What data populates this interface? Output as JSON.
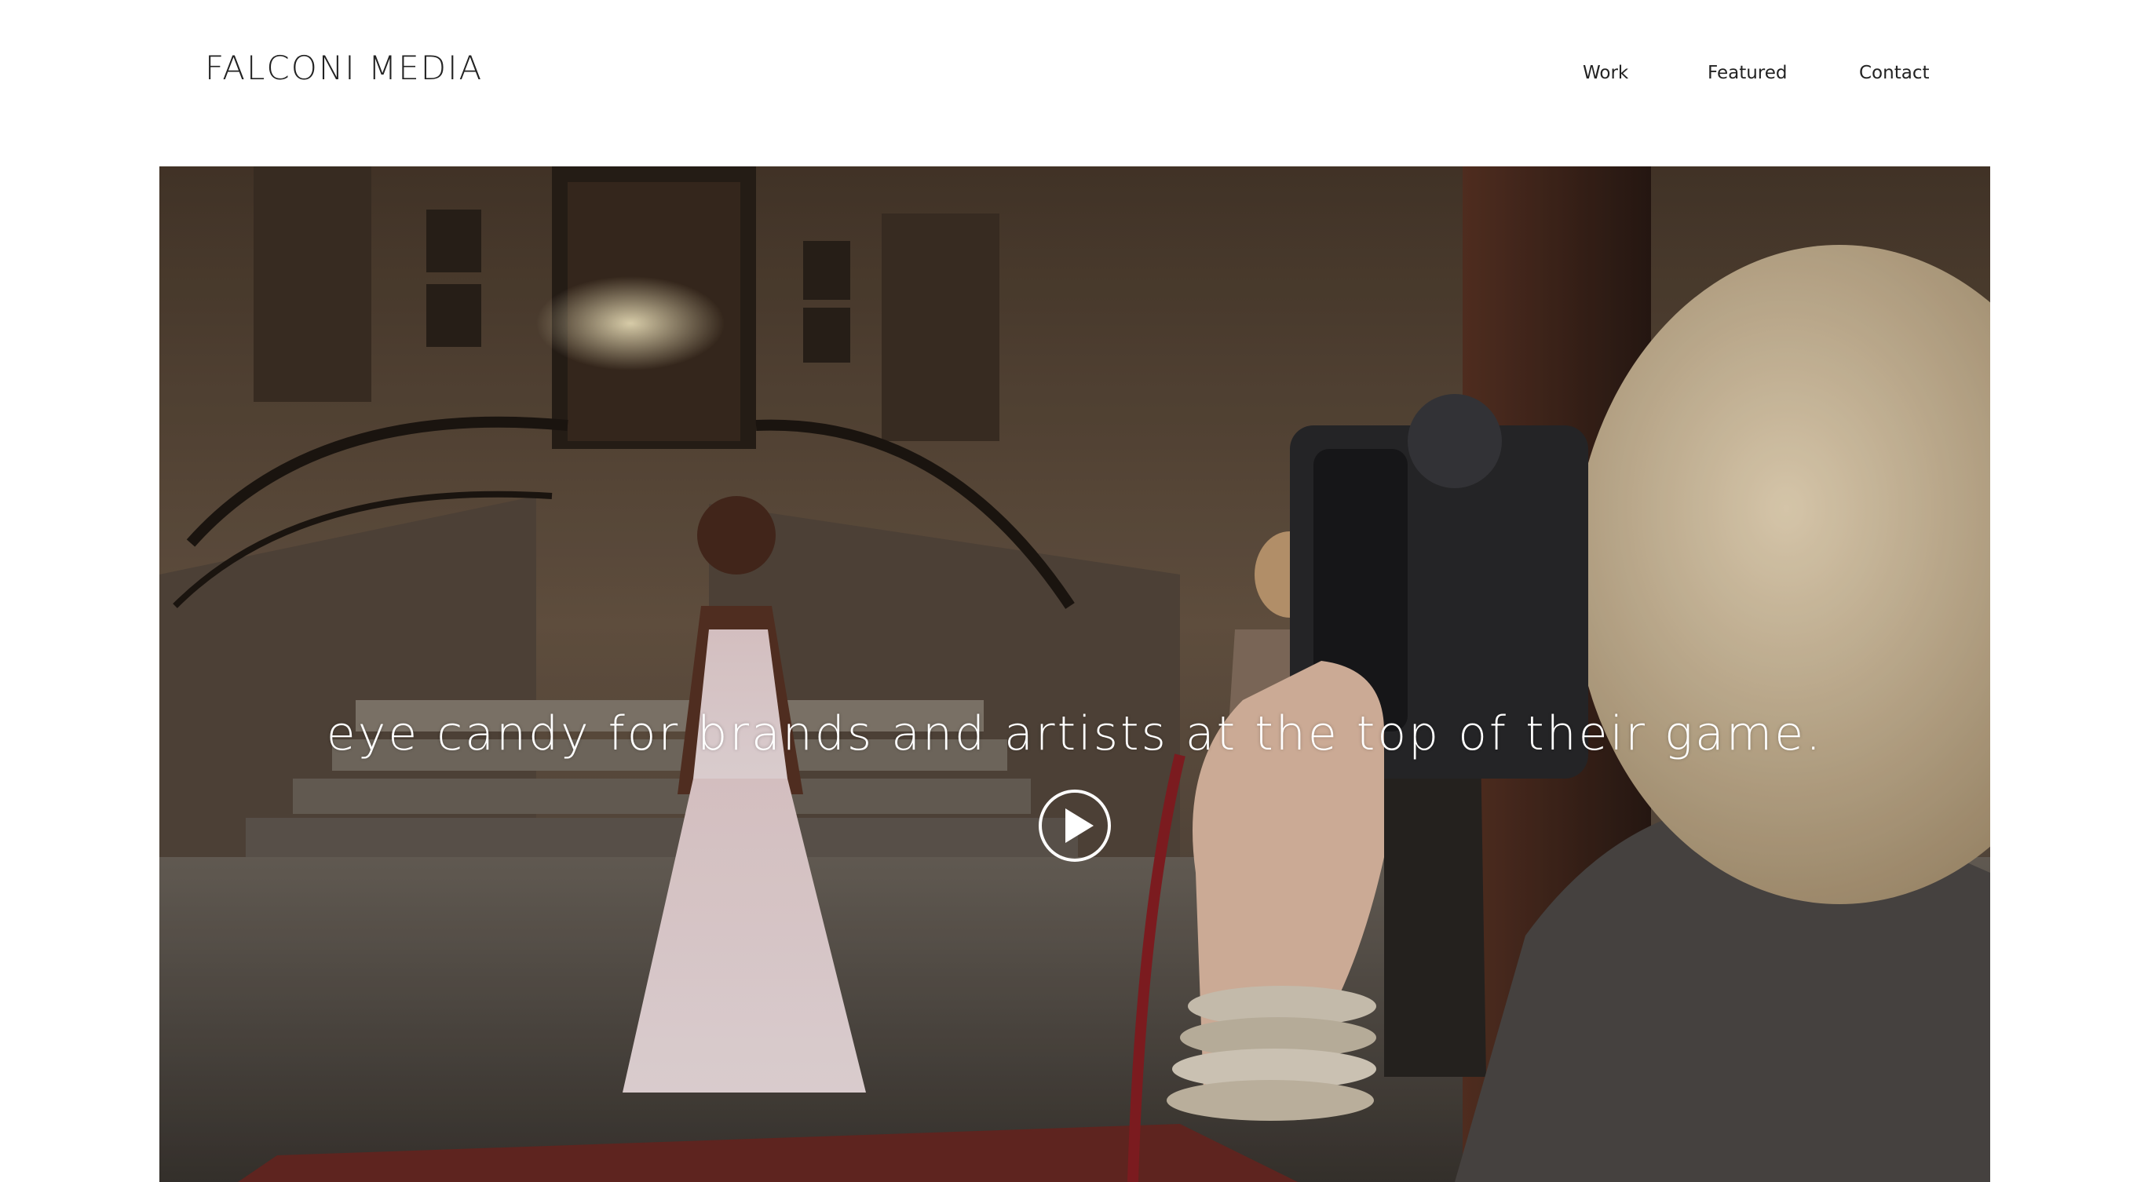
{
  "brand": {
    "name": "FALCONI MEDIA"
  },
  "nav": {
    "items": [
      {
        "label": "Work"
      },
      {
        "label": "Featured"
      },
      {
        "label": "Contact"
      }
    ]
  },
  "hero": {
    "tagline": "eye candy for brands and artists at the top of their game.",
    "play_icon": "play-circle-icon",
    "scene": "bridal fashion shoot photo"
  },
  "colors": {
    "background": "#ffffff",
    "text": "#222222",
    "hero_text": "#ffffff"
  }
}
